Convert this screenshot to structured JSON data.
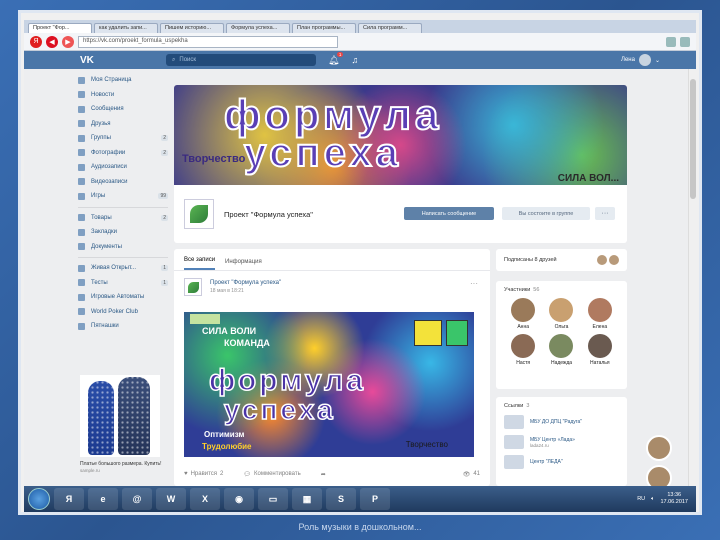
{
  "browser": {
    "tabs": [
      "Проект \"Фор...",
      "как удалить запи...",
      "Пишем историю...",
      "Формула успеха...",
      "План программы...",
      "Сила программ..."
    ],
    "url": "https://vk.com/proekt_formula_uspekha"
  },
  "vk": {
    "logo": "VK",
    "search_placeholder": "Поиск",
    "notifications": "1",
    "user_name": "Лена"
  },
  "menu": {
    "items": [
      {
        "label": "Моя Страница",
        "count": ""
      },
      {
        "label": "Новости",
        "count": ""
      },
      {
        "label": "Сообщения",
        "count": ""
      },
      {
        "label": "Друзья",
        "count": ""
      },
      {
        "label": "Группы",
        "count": "2"
      },
      {
        "label": "Фотографии",
        "count": "2"
      },
      {
        "label": "Аудиозаписи",
        "count": ""
      },
      {
        "label": "Видеозаписи",
        "count": ""
      },
      {
        "label": "Игры",
        "count": "99"
      }
    ],
    "items2": [
      {
        "label": "Товары",
        "count": "2"
      },
      {
        "label": "Закладки",
        "count": ""
      },
      {
        "label": "Документы",
        "count": ""
      }
    ],
    "items3": [
      {
        "label": "Живая Открыт...",
        "count": "1"
      },
      {
        "label": "Тесты",
        "count": "1"
      },
      {
        "label": "Игровые Автоматы",
        "count": ""
      },
      {
        "label": "World Poker Club",
        "count": ""
      },
      {
        "label": "Пятнашки",
        "count": ""
      }
    ]
  },
  "ad": {
    "text": "Платье большого размера. Купить!",
    "sub": "sample.ru"
  },
  "cover": {
    "title1": "формула",
    "title2": "успеха",
    "word_left": "Творчество",
    "word_right": "СИЛА ВОЛ..."
  },
  "group": {
    "name": "Проект \"Формула успеха\"",
    "write_button": "Написать сообщение",
    "member_button": "Вы состоите в группе",
    "more": "···"
  },
  "feed": {
    "tab_all": "Все записи",
    "tab_info": "Информация",
    "post_author": "Проект \"Формула успеха\"",
    "post_date": "18 мая в 18:21",
    "like_label": "Нравится",
    "like_count": "2",
    "comment_label": "Комментировать",
    "views": "41"
  },
  "post_image": {
    "word1": "СИЛА ВОЛИ",
    "word2": "КОМАНДА",
    "title1": "формула",
    "title2": "успеха",
    "word3": "Оптимизм",
    "word4": "Трудолюбие",
    "word5": "Творчество"
  },
  "friends": {
    "label": "Подписаны 8 друзей"
  },
  "members": {
    "title": "Участники",
    "count": "56",
    "list": [
      {
        "name": "Анна",
        "color": "#9a7a5a"
      },
      {
        "name": "Ольга",
        "color": "#c9a070"
      },
      {
        "name": "Елена",
        "color": "#b07a60"
      },
      {
        "name": "Настя",
        "color": "#8a6a55"
      },
      {
        "name": "Надежда",
        "color": "#7a8a60"
      },
      {
        "name": "Наталья",
        "color": "#6a5a50"
      }
    ]
  },
  "links": {
    "title": "Ссылки",
    "count": "3",
    "list": [
      {
        "name": "МБУ ДО ДПЦ \"Радуга\"",
        "sub": ""
      },
      {
        "name": "МБУ Центр «Лада»",
        "sub": "lada24.ru"
      },
      {
        "name": "Центр \"ЛЕДА\"",
        "sub": ""
      }
    ]
  },
  "taskbar": {
    "lang": "RU",
    "time": "13:36",
    "date": "17.06.2017"
  },
  "slide_caption": "Роль музыки в дошкольном..."
}
